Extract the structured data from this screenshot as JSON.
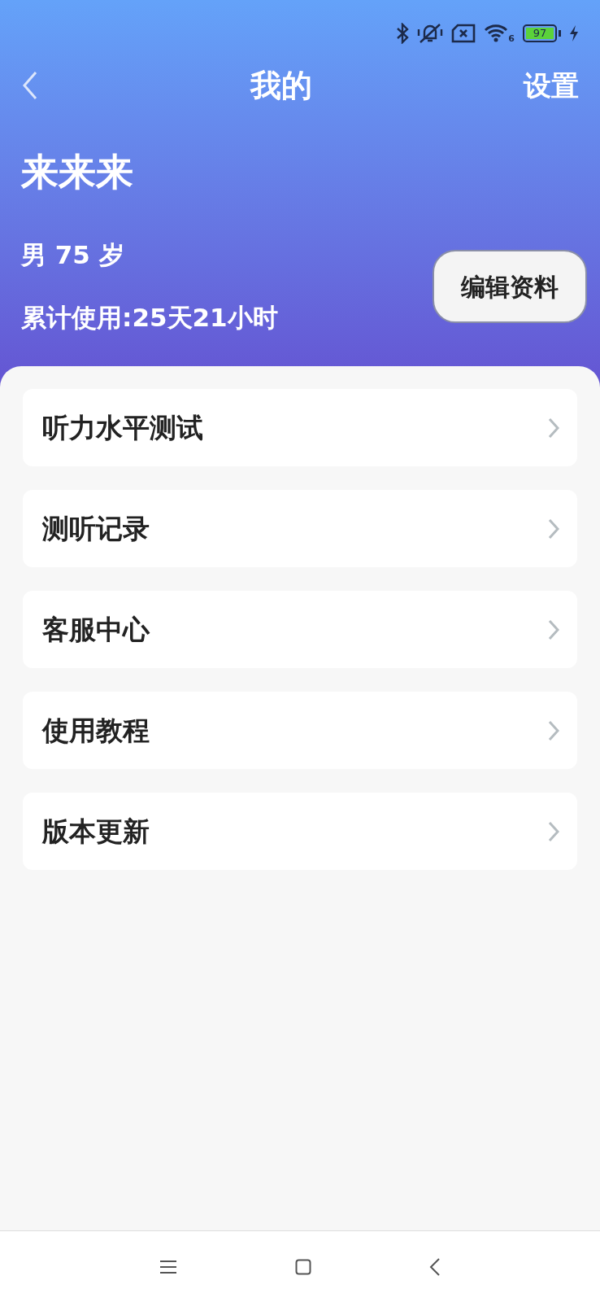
{
  "status_bar": {
    "wifi_badge": "6",
    "battery": "97"
  },
  "header": {
    "title": "我的",
    "action": "设置"
  },
  "profile": {
    "name": "来来来",
    "info": "男 75 岁",
    "usage": "累计使用:25天21小时",
    "edit_button": "编辑资料"
  },
  "menu": [
    {
      "label": "听力水平测试"
    },
    {
      "label": "测听记录"
    },
    {
      "label": "客服中心"
    },
    {
      "label": "使用教程"
    },
    {
      "label": "版本更新"
    }
  ]
}
